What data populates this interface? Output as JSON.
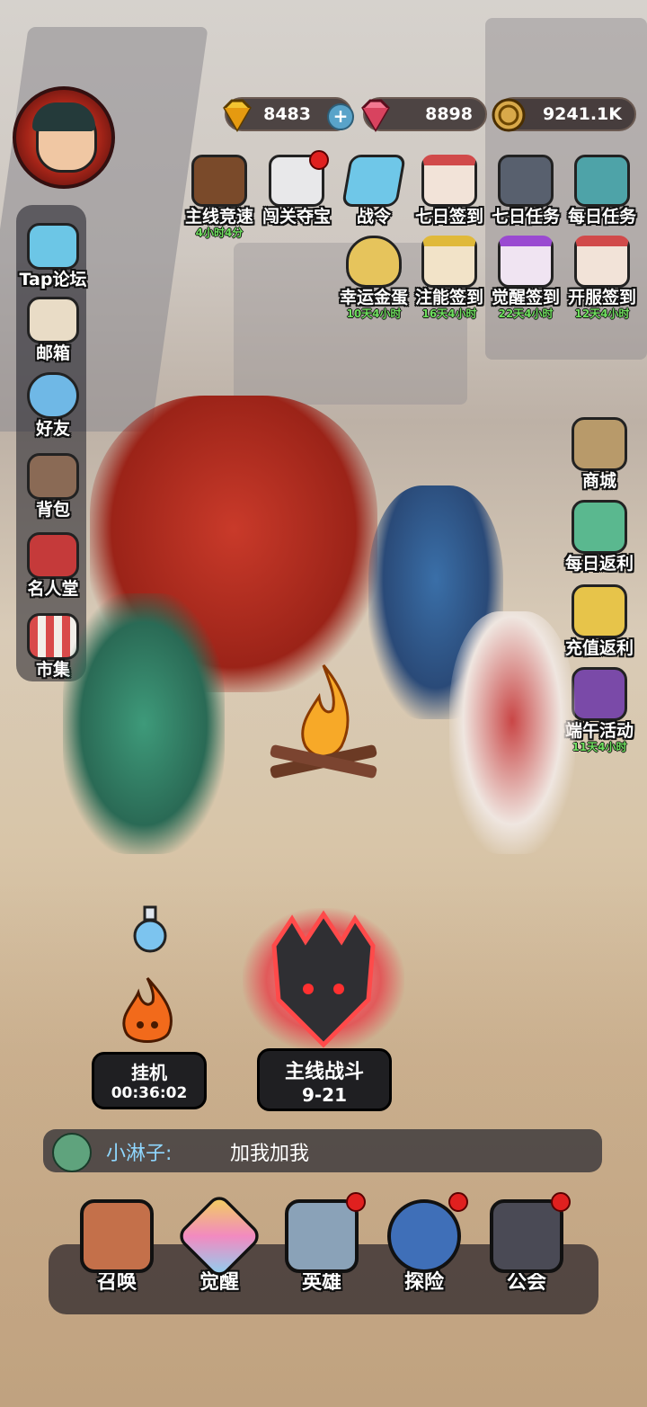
{
  "currencies": {
    "gold_gems": "8483",
    "pink_gems": "8898",
    "coins": "9241.1K"
  },
  "side_menu": [
    {
      "label": "Tap论坛",
      "icon": "chat-bubble-icon"
    },
    {
      "label": "邮箱",
      "icon": "mail-icon"
    },
    {
      "label": "好友",
      "icon": "friends-icon"
    },
    {
      "label": "背包",
      "icon": "backpack-icon"
    },
    {
      "label": "名人堂",
      "icon": "hall-of-fame-icon"
    },
    {
      "label": "市集",
      "icon": "market-icon"
    }
  ],
  "top_row1": [
    {
      "label": "主线竞速",
      "sub": "4小时4分",
      "icon": "trophy-icon"
    },
    {
      "label": "闯关夺宝",
      "sub": "",
      "icon": "wolf-icon"
    },
    {
      "label": "战令",
      "sub": "",
      "icon": "battle-pass-icon"
    },
    {
      "label": "七日签到",
      "sub": "",
      "icon": "calendar-5-icon"
    },
    {
      "label": "七日任务",
      "sub": "",
      "icon": "helmet-icon"
    },
    {
      "label": "每日任务",
      "sub": "",
      "icon": "task-book-icon"
    }
  ],
  "top_row2": [
    {
      "label": "幸运金蛋",
      "sub": "10天4小时",
      "icon": "golden-egg-icon"
    },
    {
      "label": "注能签到",
      "sub": "16天4小时",
      "icon": "calendar-12-icon"
    },
    {
      "label": "觉醒签到",
      "sub": "22天4小时",
      "icon": "calendar-8-icon"
    },
    {
      "label": "开服签到",
      "sub": "12天4小时",
      "icon": "calendar-10-icon"
    }
  ],
  "right_menu": [
    {
      "label": "商城",
      "sub": "",
      "icon": "shop-bag-icon"
    },
    {
      "label": "每日返利",
      "sub": "",
      "icon": "gift-box-icon"
    },
    {
      "label": "充值返利",
      "sub": "",
      "icon": "recharge-card-icon"
    },
    {
      "label": "端午活动",
      "sub": "11天4小时",
      "icon": "event-icon"
    }
  ],
  "idle": {
    "label": "挂机",
    "time": "00:36:02"
  },
  "main_battle": {
    "label": "主线战斗",
    "stage": "9-21"
  },
  "chat": {
    "name": "小淋子:",
    "message": "加我加我"
  },
  "dock": [
    {
      "label": "召唤",
      "icon": "summon-icon"
    },
    {
      "label": "觉醒",
      "icon": "awaken-icon"
    },
    {
      "label": "英雄",
      "icon": "hero-icon"
    },
    {
      "label": "探险",
      "icon": "compass-icon"
    },
    {
      "label": "公会",
      "icon": "guild-icon"
    }
  ]
}
